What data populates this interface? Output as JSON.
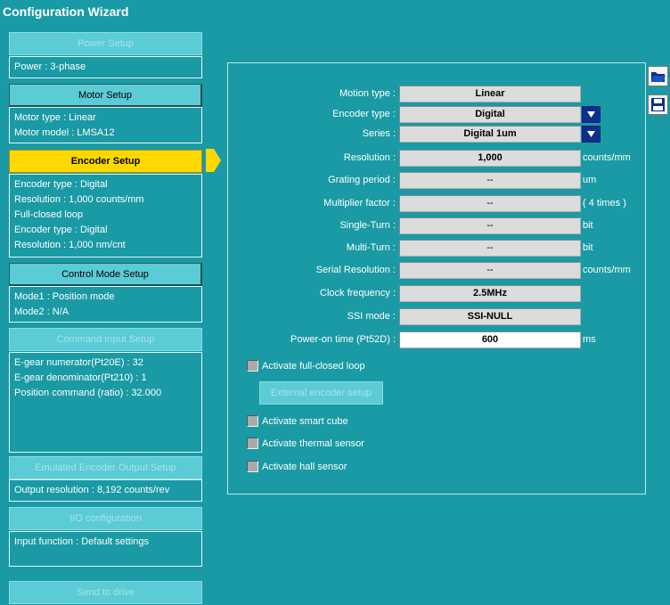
{
  "window": {
    "title": "Configuration Wizard"
  },
  "steps": {
    "power": {
      "label": "Power Setup",
      "info": [
        "Power :  3-phase"
      ]
    },
    "motor": {
      "label": "Motor Setup",
      "info": [
        "Motor type : Linear",
        "Motor model  : LMSA12"
      ]
    },
    "encoder": {
      "label": "Encoder Setup",
      "info": [
        "Encoder type : Digital",
        "Resolution : 1,000 counts/mm",
        "Full-closed loop",
        "Encoder type : Digital",
        "Resolution : 1,000 nm/cnt"
      ]
    },
    "control": {
      "label": "Control Mode Setup",
      "info": [
        "Mode1 : Position mode",
        "Mode2 : N/A"
      ]
    },
    "command": {
      "label": "Command Input Setup",
      "info": [
        "E-gear numerator(Pt20E) : 32",
        "E-gear denominator(Pt210) : 1",
        "Position command (ratio) : 32.000"
      ]
    },
    "emulated": {
      "label": "Emulated Encoder Output Setup",
      "info": [
        "Output resolution : 8,192 counts/rev"
      ]
    },
    "io": {
      "label": "I/O configuration",
      "info": [
        "Input function : Default settings"
      ]
    },
    "send": {
      "label": "Send to drive"
    }
  },
  "fields": {
    "motion_type": {
      "label": "Motion type :",
      "value": "Linear"
    },
    "encoder_type": {
      "label": "Encoder type :",
      "value": "Digital"
    },
    "series": {
      "label": "Series :",
      "value": "Digital 1um"
    },
    "resolution": {
      "label": "Resolution :",
      "value": "1,000",
      "unit": "counts/mm"
    },
    "grating_period": {
      "label": "Grating period :",
      "value": "--",
      "unit": "um"
    },
    "multiplier": {
      "label": "Multiplier factor :",
      "value": "--",
      "unit": "( 4 times )"
    },
    "single_turn": {
      "label": "Single-Turn :",
      "value": "--",
      "unit": "bit"
    },
    "multi_turn": {
      "label": "Multi-Turn :",
      "value": "--",
      "unit": "bit"
    },
    "serial_resolution": {
      "label": "Serial Resolution :",
      "value": "--",
      "unit": "counts/mm"
    },
    "clock_frequency": {
      "label": "Clock frequency :",
      "value": "2.5MHz"
    },
    "ssi_mode": {
      "label": "SSI mode :",
      "value": "SSI-NULL"
    },
    "power_on_time": {
      "label": "Power-on time (Pt52D) :",
      "value": "600",
      "unit": "ms"
    }
  },
  "options": {
    "full_closed": {
      "label": "Activate full-closed loop",
      "checked": false
    },
    "external_encoder_button": "External encoder setup",
    "smart_cube": {
      "label": "Activate smart cube",
      "checked": false
    },
    "thermal_sensor": {
      "label": "Activate thermal sensor",
      "checked": false
    },
    "hall_sensor": {
      "label": "Activate hall sensor",
      "checked": false
    }
  },
  "tools": [
    "open-folder-icon",
    "save-disk-icon"
  ],
  "colors": {
    "background": "#1a9aa5",
    "current_step": "#ffd800",
    "dropdown": "#0b2f8c"
  }
}
